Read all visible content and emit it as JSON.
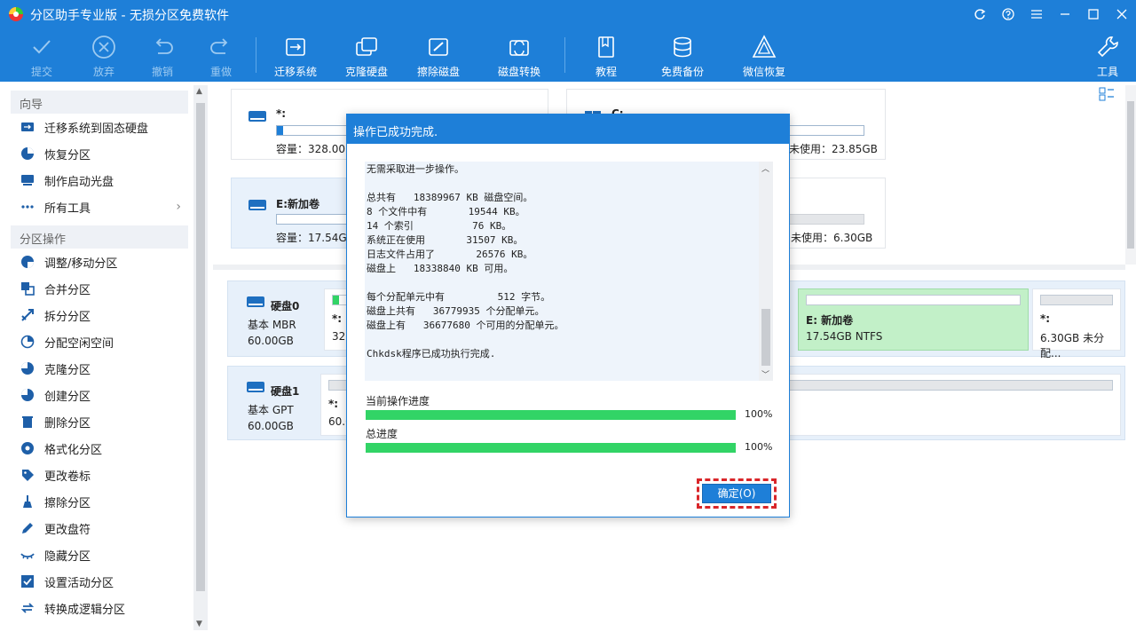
{
  "app": {
    "title": "分区助手专业版 - 无损分区免费软件"
  },
  "toolbar": {
    "submit": "提交",
    "discard": "放弃",
    "undo": "撤销",
    "redo": "重做",
    "migrate": "迁移系统",
    "clone_disk": "克隆硬盘",
    "wipe_disk": "擦除磁盘",
    "disk_convert": "磁盘转换",
    "tutorial": "教程",
    "free_backup": "免费备份",
    "wechat_recover": "微信恢复",
    "tools": "工具"
  },
  "sidebar": {
    "wizard_title": "向导",
    "wizard_items": [
      "迁移系统到固态硬盘",
      "恢复分区",
      "制作启动光盘",
      "所有工具"
    ],
    "ops_title": "分区操作",
    "ops_items": [
      "调整/移动分区",
      "合并分区",
      "拆分分区",
      "分配空闲空间",
      "克隆分区",
      "创建分区",
      "删除分区",
      "格式化分区",
      "更改卷标",
      "擦除分区",
      "更改盘符",
      "隐藏分区",
      "设置活动分区",
      "转换成逻辑分区"
    ]
  },
  "partitions": {
    "p1": {
      "name": "*:",
      "capacity": "容量：328.00MB"
    },
    "p2": {
      "name": "C:",
      "unused": "未使用：23.85GB"
    },
    "p3": {
      "name": "E:新加卷",
      "capacity": "容量：17.54GB"
    },
    "p4": {
      "unused": "未使用：6.30GB"
    }
  },
  "disks": {
    "disk0": {
      "name": "硬盘0",
      "type": "基本 MBR",
      "size": "60.00GB",
      "parts": [
        {
          "name": "*:",
          "info": "32..."
        },
        {
          "name": "E: 新加卷",
          "info": "17.54GB NTFS"
        },
        {
          "name": "*:",
          "info": "6.30GB 未分配..."
        }
      ]
    },
    "disk1": {
      "name": "硬盘1",
      "type": "基本 GPT",
      "size": "60.00GB",
      "parts": [
        {
          "name": "*:",
          "info": "60.0..."
        }
      ]
    }
  },
  "modal": {
    "title": "操作已成功完成.",
    "log": [
      "无需采取进一步操作。",
      "",
      "总共有   18389967 KB 磁盘空间。",
      "8 个文件中有       19544 KB。",
      "14 个索引          76 KB。",
      "系统正在使用       31507 KB。",
      "日志文件占用了       26576 KB。",
      "磁盘上   18338840 KB 可用。",
      "",
      "每个分配单元中有         512 字节。",
      "磁盘上共有   36779935 个分配单元。",
      "磁盘上有   36677680 个可用的分配单元。",
      "",
      "Chkdsk程序已成功执行完成."
    ],
    "current_label": "当前操作进度",
    "current_pct": "100%",
    "current_value": 1.0,
    "total_label": "总进度",
    "total_pct": "100%",
    "total_value": 1.0,
    "ok_label": "确定(O)"
  },
  "colors": {
    "accent": "#1e7fd8",
    "progress": "#32d466",
    "highlight": "#d9262a",
    "ntfs_selected": "#c2f0c8"
  }
}
